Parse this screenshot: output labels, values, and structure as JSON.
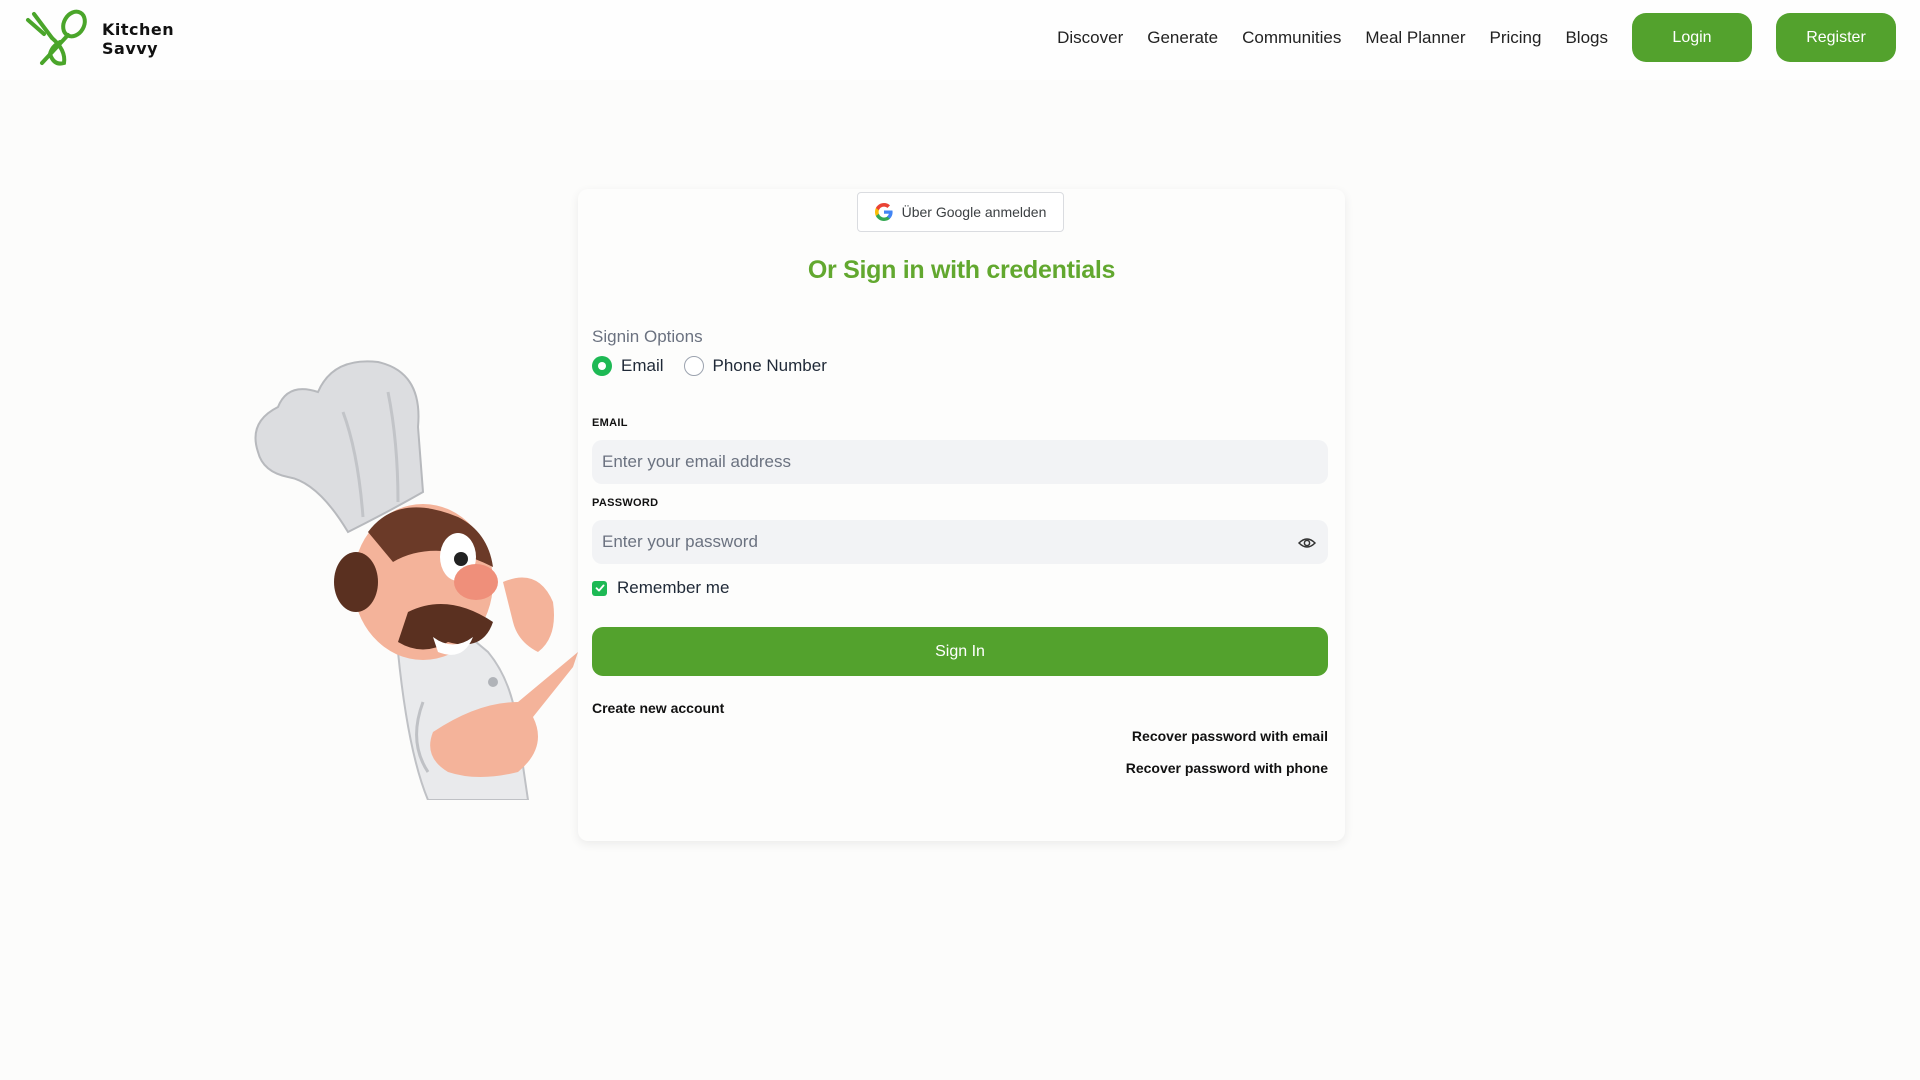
{
  "header": {
    "brand_line1": "Kitchen",
    "brand_line2": "Savvy",
    "nav": [
      "Discover",
      "Generate",
      "Communities",
      "Meal Planner",
      "Pricing",
      "Blogs"
    ],
    "login_label": "Login",
    "register_label": "Register"
  },
  "auth": {
    "google_label": "Über Google anmelden",
    "or_title": "Or Sign in with credentials",
    "signin_options_label": "Signin Options",
    "options": [
      {
        "label": "Email",
        "selected": true
      },
      {
        "label": "Phone Number",
        "selected": false
      }
    ],
    "email_label": "EMAIL",
    "email_placeholder": "Enter your email address",
    "password_label": "PASSWORD",
    "password_placeholder": "Enter your password",
    "remember_label": "Remember me",
    "remember_checked": true,
    "signin_label": "Sign In",
    "create_account": "Create new account",
    "recover_email": "Recover password with email",
    "recover_phone": "Recover password with phone"
  },
  "colors": {
    "brand_green": "#53a22d",
    "title_green": "#62a82f",
    "radio_green": "#1db954"
  },
  "icons": [
    "kitchen-savvy-logo-icon",
    "google-icon",
    "eye-icon",
    "check-icon"
  ]
}
